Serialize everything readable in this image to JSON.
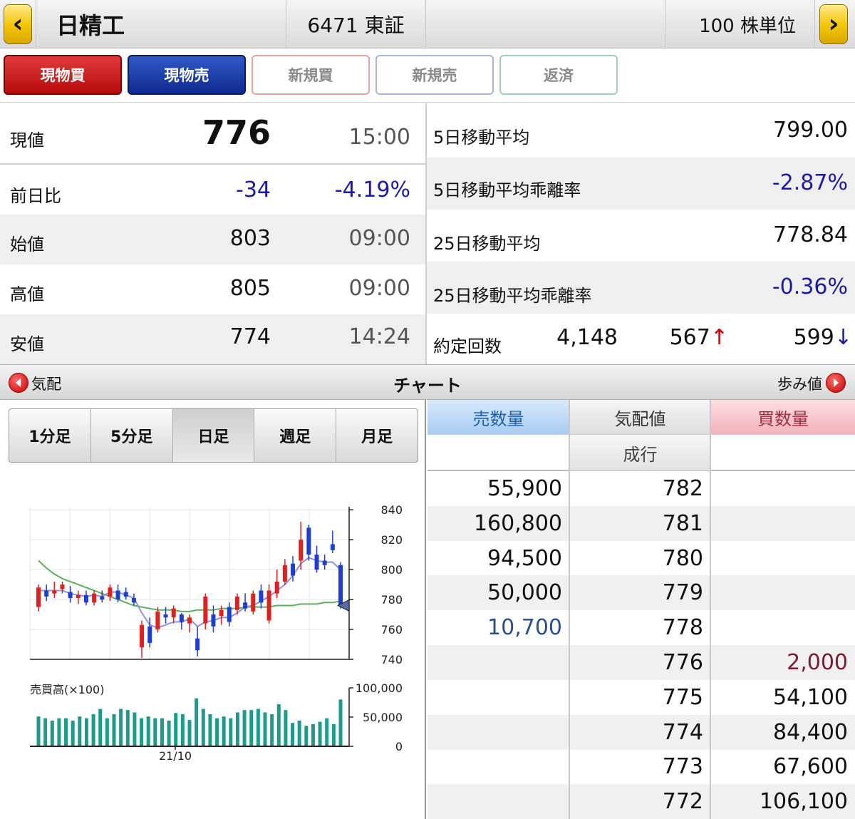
{
  "header": {
    "stock_name": "日精工",
    "code_exchange": "6471 東証",
    "unit": "100 株単位",
    "prev_icon": "chevron-left-icon",
    "next_icon": "chevron-right-icon"
  },
  "actions": [
    "現物買",
    "現物売",
    "新規買",
    "新規売",
    "返済"
  ],
  "quote": {
    "current": {
      "label": "現値",
      "value": "776",
      "time": "15:00"
    },
    "change": {
      "label": "前日比",
      "value": "-34",
      "pct": "-4.19%"
    },
    "open": {
      "label": "始値",
      "value": "803",
      "time": "09:00"
    },
    "high": {
      "label": "高値",
      "value": "805",
      "time": "09:00"
    },
    "low": {
      "label": "安値",
      "value": "774",
      "time": "14:24"
    }
  },
  "stats": {
    "ma5": {
      "label": "5日移動平均",
      "value": "799.00"
    },
    "ma5_dev": {
      "label": "5日移動平均乖離率",
      "value": "-2.87%"
    },
    "ma25": {
      "label": "25日移動平均",
      "value": "778.84"
    },
    "ma25_dev": {
      "label": "25日移動平均乖離率",
      "value": "-0.36%"
    },
    "trades": {
      "label": "約定回数",
      "count": "4,148",
      "up": "567",
      "down": "599",
      "up_arrow": "↑",
      "down_arrow": "↓"
    }
  },
  "section": {
    "left": "気配",
    "center": "チャート",
    "right": "歩み値"
  },
  "chart_tabs": [
    "1分足",
    "5分足",
    "日足",
    "週足",
    "月足"
  ],
  "chart_tab_selected": 2,
  "chart_data": {
    "type": "candlestick",
    "price_axis": {
      "ticks": [
        840,
        820,
        800,
        780,
        760,
        740
      ],
      "range": [
        740,
        842
      ]
    },
    "volume_axis": {
      "label": "売買高(×100)",
      "ticks": [
        "100,000",
        "50,000",
        "0"
      ],
      "range": [
        0,
        100000
      ]
    },
    "x_label": "21/10",
    "candles": [
      {
        "o": 775,
        "h": 790,
        "l": 772,
        "c": 788
      },
      {
        "o": 786,
        "h": 790,
        "l": 779,
        "c": 782
      },
      {
        "o": 784,
        "h": 792,
        "l": 781,
        "c": 786
      },
      {
        "o": 787,
        "h": 792,
        "l": 784,
        "c": 790
      },
      {
        "o": 785,
        "h": 789,
        "l": 778,
        "c": 781
      },
      {
        "o": 781,
        "h": 786,
        "l": 777,
        "c": 783
      },
      {
        "o": 783,
        "h": 786,
        "l": 776,
        "c": 778
      },
      {
        "o": 778,
        "h": 786,
        "l": 776,
        "c": 784
      },
      {
        "o": 782,
        "h": 786,
        "l": 778,
        "c": 780
      },
      {
        "o": 782,
        "h": 790,
        "l": 779,
        "c": 788
      },
      {
        "o": 786,
        "h": 790,
        "l": 778,
        "c": 780
      },
      {
        "o": 785,
        "h": 788,
        "l": 780,
        "c": 782
      },
      {
        "o": 781,
        "h": 784,
        "l": 776,
        "c": 778
      },
      {
        "o": 748,
        "h": 766,
        "l": 741,
        "c": 763
      },
      {
        "o": 762,
        "h": 768,
        "l": 748,
        "c": 751
      },
      {
        "o": 760,
        "h": 775,
        "l": 758,
        "c": 772
      },
      {
        "o": 770,
        "h": 775,
        "l": 764,
        "c": 768
      },
      {
        "o": 768,
        "h": 776,
        "l": 764,
        "c": 774
      },
      {
        "o": 770,
        "h": 771,
        "l": 760,
        "c": 765
      },
      {
        "o": 764,
        "h": 770,
        "l": 758,
        "c": 768
      },
      {
        "o": 754,
        "h": 762,
        "l": 742,
        "c": 746
      },
      {
        "o": 764,
        "h": 784,
        "l": 760,
        "c": 782
      },
      {
        "o": 770,
        "h": 776,
        "l": 758,
        "c": 762
      },
      {
        "o": 769,
        "h": 776,
        "l": 763,
        "c": 773
      },
      {
        "o": 775,
        "h": 778,
        "l": 762,
        "c": 765
      },
      {
        "o": 773,
        "h": 784,
        "l": 770,
        "c": 782
      },
      {
        "o": 778,
        "h": 784,
        "l": 772,
        "c": 774
      },
      {
        "o": 772,
        "h": 786,
        "l": 770,
        "c": 784
      },
      {
        "o": 786,
        "h": 790,
        "l": 774,
        "c": 778
      },
      {
        "o": 766,
        "h": 790,
        "l": 764,
        "c": 786
      },
      {
        "o": 784,
        "h": 800,
        "l": 781,
        "c": 792
      },
      {
        "o": 792,
        "h": 807,
        "l": 790,
        "c": 803
      },
      {
        "o": 804,
        "h": 809,
        "l": 792,
        "c": 796
      },
      {
        "o": 806,
        "h": 832,
        "l": 800,
        "c": 820
      },
      {
        "o": 828,
        "h": 830,
        "l": 806,
        "c": 810
      },
      {
        "o": 810,
        "h": 816,
        "l": 798,
        "c": 800
      },
      {
        "o": 806,
        "h": 810,
        "l": 800,
        "c": 803
      },
      {
        "o": 817,
        "h": 826,
        "l": 811,
        "c": 813
      },
      {
        "o": 803,
        "h": 805,
        "l": 774,
        "c": 776
      }
    ],
    "ma5": [
      786,
      786,
      786,
      786,
      784,
      783,
      782,
      783,
      782,
      785,
      785,
      783,
      781,
      771,
      763,
      761,
      763,
      765,
      765,
      767,
      762,
      765,
      766,
      768,
      768,
      771,
      775,
      776,
      779,
      782,
      786,
      790,
      796,
      804,
      808,
      806,
      805,
      805,
      800
    ],
    "ma25": [
      806,
      801,
      797,
      794,
      792,
      790,
      788,
      786,
      784,
      782,
      780,
      778,
      776,
      775,
      774,
      773,
      773,
      773,
      772,
      772,
      773,
      773,
      773,
      774,
      774,
      774,
      775,
      775,
      775,
      775,
      776,
      776,
      776,
      777,
      777,
      777,
      778,
      778,
      779
    ],
    "volume": [
      51000,
      48000,
      44000,
      48000,
      48000,
      44000,
      51000,
      48000,
      55000,
      64000,
      48000,
      55000,
      64000,
      62000,
      58000,
      48000,
      51000,
      48000,
      48000,
      44000,
      57000,
      55000,
      45000,
      82000,
      64000,
      55000,
      48000,
      51000,
      48000,
      58000,
      62000,
      62000,
      64000,
      58000,
      55000,
      72000,
      62000,
      40000,
      44000,
      35000,
      38000,
      42000,
      48000,
      38000,
      80000
    ]
  },
  "book": {
    "headers": {
      "sell": "売数量",
      "price": "気配値",
      "buy": "買数量"
    },
    "market_label": "成行",
    "rows": [
      {
        "sell": "55,900",
        "price": "782",
        "buy": ""
      },
      {
        "sell": "160,800",
        "price": "781",
        "buy": ""
      },
      {
        "sell": "94,500",
        "price": "780",
        "buy": ""
      },
      {
        "sell": "50,000",
        "price": "779",
        "buy": ""
      },
      {
        "sell": "10,700",
        "price": "778",
        "buy": ""
      },
      {
        "sell": "",
        "price": "776",
        "buy": "2,000"
      },
      {
        "sell": "",
        "price": "775",
        "buy": "54,100"
      },
      {
        "sell": "",
        "price": "774",
        "buy": "84,400"
      },
      {
        "sell": "",
        "price": "773",
        "buy": "67,600"
      },
      {
        "sell": "",
        "price": "772",
        "buy": "106,100"
      }
    ],
    "colors": {
      "sell_highlight": "#2a4f8f",
      "buy_highlight": "#7a1b2e",
      "sell_header": "#bcd8f7",
      "buy_header": "#f7c7ce"
    }
  }
}
